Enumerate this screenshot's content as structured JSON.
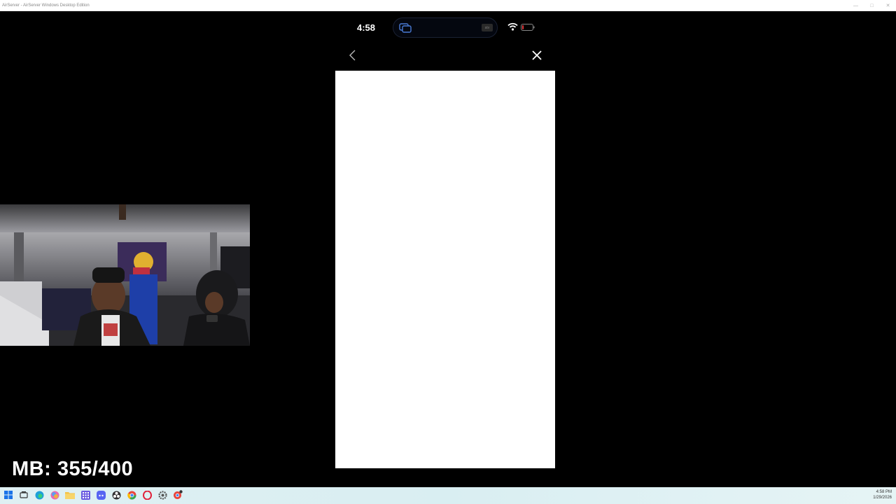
{
  "window": {
    "title": "AirServer - AirServer Windows Desktop Edition",
    "controls": [
      "minimize",
      "maximize",
      "close"
    ]
  },
  "phone": {
    "status_time": "4:58",
    "island_right_label": "atv",
    "nav": {
      "back_icon": "chevron-left-icon",
      "close_icon": "close-icon"
    }
  },
  "overlay": {
    "counter_text": "MB: 355/400"
  },
  "taskbar": {
    "apps": [
      "start-icon",
      "task-view-icon",
      "edge-icon",
      "copilot-icon",
      "file-explorer-icon",
      "apps-icon",
      "discord-icon",
      "obs-icon",
      "chrome-icon",
      "opera-icon",
      "settings-icon",
      "chrome-profile-icon"
    ],
    "clock_time": "4:58 PM",
    "clock_date": "1/29/2026"
  },
  "colors": {
    "background": "#000000",
    "webview": "#ffffff",
    "taskbar": "#dff0f3"
  }
}
